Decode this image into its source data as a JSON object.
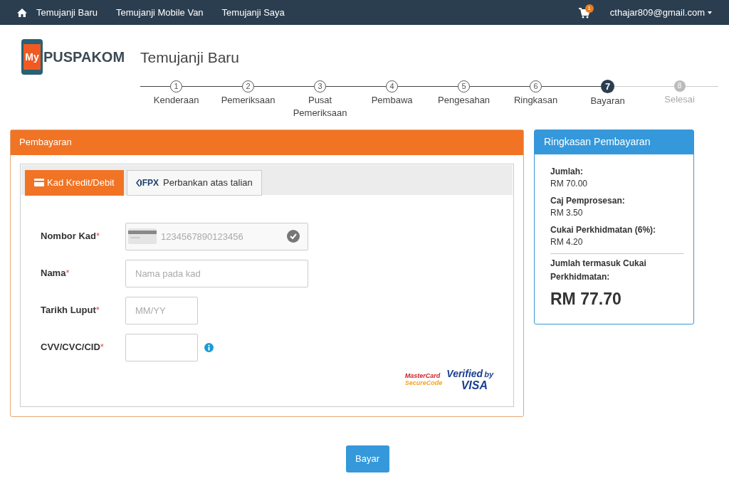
{
  "navbar": {
    "links": [
      "Temujanji Baru",
      "Temujanji Mobile Van",
      "Temujanji Saya"
    ],
    "cart_count": "1",
    "user": "cthajar809@gmail.com"
  },
  "logo": {
    "badge": "My",
    "name": "PUSPAKOM"
  },
  "page_title": "Temujanji Baru",
  "steps": [
    {
      "number": "1",
      "label": "Kenderaan",
      "reached": true,
      "selected": false
    },
    {
      "number": "2",
      "label": "Pemeriksaan",
      "reached": true,
      "selected": false
    },
    {
      "number": "3",
      "label": "Pusat Pemeriksaan",
      "reached": true,
      "selected": false
    },
    {
      "number": "4",
      "label": "Pembawa",
      "reached": true,
      "selected": false
    },
    {
      "number": "5",
      "label": "Pengesahan",
      "reached": true,
      "selected": false
    },
    {
      "number": "6",
      "label": "Ringkasan",
      "reached": true,
      "selected": false
    },
    {
      "number": "7",
      "label": "Bayaran",
      "reached": true,
      "selected": true
    },
    {
      "number": "8",
      "label": "Selesai",
      "reached": false,
      "selected": false
    }
  ],
  "payment_panel": {
    "title": "Pembayaran",
    "tabs": [
      {
        "label": "Kad Kredit/Debit",
        "kind": "card",
        "selected": true
      },
      {
        "badge": "FPX",
        "label": "Perbankan atas talian",
        "kind": "fpx",
        "selected": false
      }
    ],
    "fields": [
      {
        "label": "Nombor Kad",
        "required": "*",
        "placeholder": "1234567890123456",
        "kind": "card"
      },
      {
        "label": "Nama",
        "required": "*",
        "placeholder": "Nama pada kad",
        "kind": "name"
      },
      {
        "label": "Tarikh Luput",
        "required": "*",
        "placeholder": "MM/YY",
        "kind": "expiry"
      },
      {
        "label": "CVV/CVC/CID",
        "required": "*",
        "kind": "cvv"
      }
    ],
    "secure_marks": {
      "mastercard": [
        "MasterCard",
        "SecureCode"
      ],
      "visa": [
        "Verified",
        "by",
        "VISA"
      ]
    }
  },
  "summary_panel": {
    "title": "Ringkasan Pembayaran",
    "items": [
      {
        "label": "Jumlah:",
        "value": "RM 70.00"
      },
      {
        "label": "Caj Pemprosesan:",
        "value": "RM 3.50"
      },
      {
        "label": "Cukai Perkhidmatan (6%):",
        "value": "RM 4.20"
      }
    ],
    "total_label": "Jumlah termasuk Cukai Perkhidmatan:",
    "total": "RM 77.70"
  },
  "pay_button": "Bayar"
}
